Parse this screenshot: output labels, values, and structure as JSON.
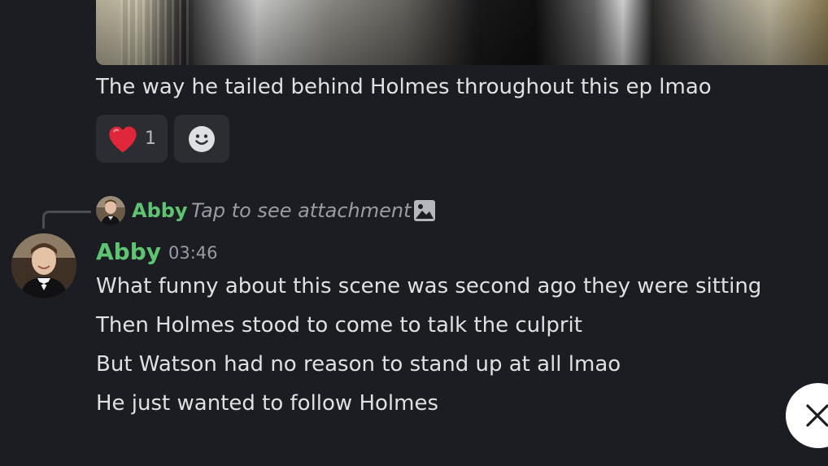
{
  "previous_message": {
    "text": "The way he tailed behind Holmes throughout this ep lmao",
    "reactions": [
      {
        "emoji": "heart",
        "count": "1"
      }
    ],
    "add_reaction_icon": "smile-icon"
  },
  "reply": {
    "author": "Abby",
    "snippet": "Tap to see attachment",
    "attachment_icon": "image-icon"
  },
  "message": {
    "author": "Abby",
    "timestamp": "03:46",
    "lines": [
      "What funny about this scene was second ago they were sitting",
      "Then Holmes stood to come to talk the culprit",
      "But Watson had no reason to stand up at all lmao",
      "He just wanted to follow Holmes"
    ]
  },
  "colors": {
    "background": "#1c1d22",
    "author": "#5fc472",
    "reaction_bg": "#2b2d33",
    "heart": "#e0263b"
  }
}
